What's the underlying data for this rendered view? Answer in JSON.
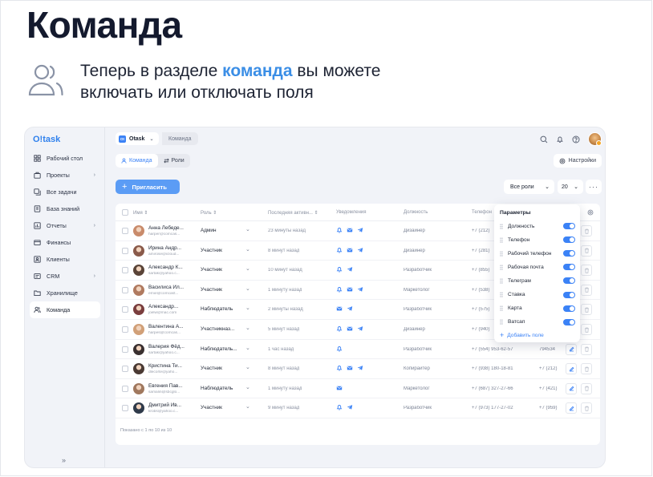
{
  "hero": {
    "title": "Команда",
    "line1_before": "Теперь в разделе ",
    "line1_highlight": "команда",
    "line1_after": " вы можете",
    "line2": "включать или отключать поля",
    "icon": "users-icon"
  },
  "app": {
    "logo": "O!task",
    "sidebar": {
      "items": [
        {
          "label": "Рабочий стол",
          "icon": "grid-icon",
          "chevron": false,
          "active": false
        },
        {
          "label": "Проекты",
          "icon": "briefcase-icon",
          "chevron": true,
          "active": false
        },
        {
          "label": "Все задачи",
          "icon": "tasks-icon",
          "chevron": false,
          "active": false
        },
        {
          "label": "База знаний",
          "icon": "book-icon",
          "chevron": false,
          "active": false
        },
        {
          "label": "Отчеты",
          "icon": "chart-icon",
          "chevron": true,
          "active": false
        },
        {
          "label": "Финансы",
          "icon": "wallet-icon",
          "chevron": false,
          "active": false
        },
        {
          "label": "Клиенты",
          "icon": "contacts-icon",
          "chevron": false,
          "active": false
        },
        {
          "label": "CRM",
          "icon": "crm-icon",
          "chevron": true,
          "active": false
        },
        {
          "label": "Хранилище",
          "icon": "folder-icon",
          "chevron": false,
          "active": false
        },
        {
          "label": "Команда",
          "icon": "team-icon",
          "chevron": false,
          "active": true
        }
      ],
      "collapse": "»"
    },
    "header": {
      "workspace": "Otask",
      "workspace_badge": "Ot",
      "breadcrumb": "Команда"
    },
    "tabs": [
      {
        "label": "Команда",
        "active": true
      },
      {
        "label": "Роли",
        "active": false
      }
    ],
    "settings_label": "Настройки",
    "invite_label": "Пригласить",
    "roles_filter": "Все роли",
    "per_page": "20",
    "table": {
      "headers": {
        "name": "Имя",
        "role": "Роль",
        "last": "Последняя активн...",
        "notif": "Уведомления",
        "position": "Должность",
        "phone": "Телефон"
      },
      "rows": [
        {
          "name": "Анна Лебеде...",
          "email": "harper@comcas...",
          "role": "Админ",
          "last": "23 минуты назад",
          "notif": [
            "bell",
            "mail",
            "telegram"
          ],
          "position": "Дизайнер",
          "phone": "+7 (212)",
          "phone2": "",
          "avatar": "#c98b6b"
        },
        {
          "name": "Ирина Андр...",
          "email": "amirose@icloud...",
          "role": "Участник",
          "last": "8 минут назад",
          "notif": [
            "bell",
            "mail",
            "telegram"
          ],
          "position": "Дизайнер",
          "phone": "+7 (281)",
          "phone2": "",
          "avatar": "#8a5a4a"
        },
        {
          "name": "Александр К...",
          "email": "sartak@yahoo.c...",
          "role": "Участник",
          "last": "10 минут назад",
          "notif": [
            "bell",
            "telegram"
          ],
          "position": "Разработчик",
          "phone": "+7 (855)",
          "phone2": "",
          "avatar": "#5a4438"
        },
        {
          "name": "Василиса Ил...",
          "email": "ernie@comcast...",
          "role": "Участник",
          "last": "1 минуту назад",
          "notif": [
            "bell",
            "mail",
            "telegram"
          ],
          "position": "Маркетолог",
          "phone": "+7 (538)",
          "phone2": "",
          "avatar": "#b07a60"
        },
        {
          "name": "Александр...",
          "email": "joelw@mac.com",
          "role": "Наблюдатель",
          "last": "2 минуты назад",
          "notif": [
            "mail",
            "telegram"
          ],
          "position": "Разработчик",
          "phone": "+7 (575)",
          "phone2": "",
          "avatar": "#7a3e3e"
        },
        {
          "name": "Валентина А...",
          "email": "harpes@comcas...",
          "role": "Участникназ...",
          "last": "5 минут назад",
          "notif": [
            "bell",
            "mail",
            "telegram"
          ],
          "position": "Дизайнер",
          "phone": "+7 (940)",
          "phone2": "",
          "avatar": "#d1a078"
        },
        {
          "name": "Валерия Фёд...",
          "email": "sartak@yahoo.c...",
          "role": "Наблюдатель...",
          "last": "1 час назад",
          "notif": [
            "bell"
          ],
          "position": "Разработчик",
          "phone": "+7 (554) 953-62-57",
          "phone2": "794534",
          "avatar": "#3a3030"
        },
        {
          "name": "Кристина Ти...",
          "email": "dlecorte@yaho...",
          "role": "Участник",
          "last": "8 минут назад",
          "notif": [
            "bell",
            "mail",
            "telegram"
          ],
          "position": "Копирайтер",
          "phone": "+7 (938) 180-18-81",
          "phone2": "+7 (212)",
          "avatar": "#4a3a34"
        },
        {
          "name": "Евгения Пав...",
          "email": "samalin@sbcglo...",
          "role": "Наблюдатель",
          "last": "1 минуту назад",
          "notif": [
            "mail"
          ],
          "position": "Маркетолог",
          "phone": "+7 (687) 327-27-66",
          "phone2": "+7 (421)",
          "avatar": "#a0785e"
        },
        {
          "name": "Дмитрий Ив...",
          "email": "krobs@yahoo.c...",
          "role": "Участник",
          "last": "9 минут назад",
          "notif": [
            "bell",
            "telegram"
          ],
          "position": "Разработчик",
          "phone": "+7 (973) 177-27-02",
          "phone2": "+7 (959)",
          "avatar": "#2f3a4a"
        }
      ]
    },
    "footer": "Показано с 1 по 10 из 10",
    "params": {
      "title": "Параметры",
      "items": [
        "Должность",
        "Телефон",
        "Рабочий телефон",
        "Рабочая почта",
        "Телеграм",
        "Ставка",
        "Карта",
        "Ватсап"
      ],
      "add_label": "Добавить поле"
    },
    "colors": {
      "accent": "#3b82f6",
      "button": "#5b9cf5",
      "highlight": "#3b8ee6"
    }
  }
}
